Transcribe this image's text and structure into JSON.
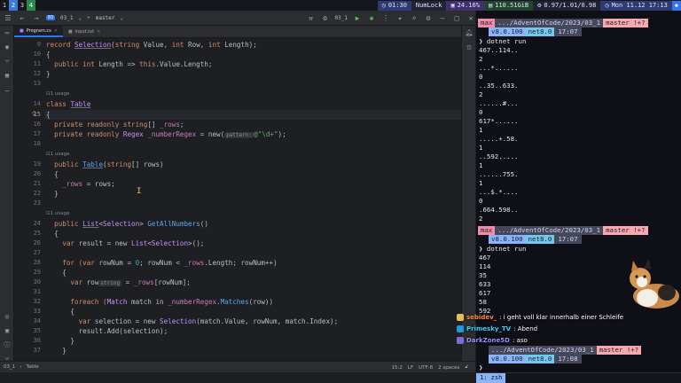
{
  "sysbar": {
    "workspaces": [
      "1",
      "2",
      "3",
      "4"
    ],
    "time_pill": "01:30",
    "numlock": "NumLock",
    "cpu": "24.16%",
    "mem": "110.51GiB",
    "load": "0.97/1.01/0.98",
    "datetime": "Mon 11.12 17:13"
  },
  "ide": {
    "project_badge": "03",
    "project_name": "03_1",
    "branch": "master",
    "config": "03_1",
    "tabs": [
      {
        "label": "Program.cs"
      },
      {
        "label": "input.txt"
      }
    ],
    "lines": [
      {
        "n": "9"
      },
      {
        "n": "10"
      },
      {
        "n": "11"
      },
      {
        "n": "12"
      },
      {
        "n": "13"
      },
      {
        "n": "14"
      },
      {
        "n": "15"
      },
      {
        "n": "16"
      },
      {
        "n": "17"
      },
      {
        "n": "18"
      },
      {
        "n": "19"
      },
      {
        "n": "20"
      },
      {
        "n": "21"
      },
      {
        "n": "22"
      },
      {
        "n": "23"
      },
      {
        "n": "24"
      },
      {
        "n": "25"
      },
      {
        "n": "26"
      },
      {
        "n": "27"
      },
      {
        "n": "28"
      },
      {
        "n": "29"
      },
      {
        "n": "30"
      },
      {
        "n": "31"
      },
      {
        "n": "32"
      },
      {
        "n": "33"
      },
      {
        "n": "34"
      },
      {
        "n": "35"
      },
      {
        "n": "36"
      },
      {
        "n": "37"
      }
    ],
    "hint_1usage": "1 usage",
    "inlay_pattern": "pattern:",
    "inlay_string": "string",
    "code": {
      "l9a": "record ",
      "l9b": "Selection",
      "l9c": "(",
      "l9d": "string",
      " l9e": "",
      "l9f": " Value, ",
      "l9g": "int",
      " l9h": "",
      "l9i": " Row, ",
      "l9j": "int",
      "l9k": " Length);",
      "l10": "{",
      "l11a": "  public ",
      "l11b": "int",
      " l11c": "",
      "l11d": " Length => ",
      "l11e": "this",
      ".l11f": "",
      "l11g": ".Value.Length;",
      "l12": "}",
      "l14a": "class ",
      "l14b": "Table",
      "l15": "{",
      "l16a": "  private readonly ",
      "l16b": "string",
      "l16c": "[] ",
      "l16d": "_rows",
      ";l16e": "",
      "l16f": ";",
      "l17a": "  private readonly ",
      "l17b": "Regex ",
      "l17c": "_numberRegex",
      " l17d": "",
      "l17e": " = new(",
      "l17f": "@\"\\d+\"",
      "l17g": ");",
      "l19a": "  public ",
      "l19b": "Table",
      "l19c": "(",
      "l19d": "string",
      "l19e": "[] rows)",
      "l20": "  {",
      "l21a": "    ",
      "l21b": "_rows",
      " l21c": "",
      "l21d": " = rows;",
      "l22": "  }",
      "l24a": "  public ",
      "l24b": "List",
      "l24c": "<",
      "l24d": "Selection",
      "l24e": "> ",
      "l24f": "GetAllNumbers",
      "l24g": "()",
      "l25": "  {",
      "l26a": "    var ",
      "l26b": "result = new ",
      "l26c": "List",
      "l26d": "<",
      "l26e": "Selection",
      "l26f": ">();",
      "l28a": "    for (",
      "l28b": "var ",
      "l28c": "rowNum = ",
      "l28d": "0",
      "l28e": "; rowNum < ",
      "l28f": "_rows",
      ".l28g": "",
      "l28h": ".Length; rowNum++)",
      "l29": "    {",
      "l30a": "      var ",
      "l30b": "row",
      "l30c": " = ",
      "l30d": "_rows",
      "l30e": "[rowNum];",
      "l32a": "      foreach (",
      "l32b": "Match ",
      "l32c": "match in ",
      "l32d": "_numberRegex",
      "l32e": ".",
      "l32f": "Matches",
      "l32g": "(row))",
      "l33": "      {",
      "l34a": "        var ",
      "l34b": "selection = new ",
      "l34c": "Selection",
      "l34d": "(match.Value, rowNum, match.Index);",
      "l35": "        result.Add(selection);",
      "l36": "      }",
      "l37": "    }"
    },
    "status": {
      "crumb1": "03_1",
      "crumb2": "Table",
      "pos": "15:2",
      "lf": "LF",
      "enc": "UTF-8",
      "indent": "2 spaces"
    }
  },
  "terminal": {
    "prompt1": {
      "user": "max",
      "path": ".../AdventOfCode/2023/03_1",
      "git": "master !+?",
      "ver": "v8.0.100",
      "net": "net8.0",
      "time": "17:07"
    },
    "cmd1": "❯ dotnet run",
    "out1": [
      "467..114..",
      "2",
      "...*......",
      "0",
      "..35..633.",
      "2",
      "......#...",
      "0",
      "617*......",
      "1",
      ".....+.58.",
      "1",
      "..592.....",
      "1",
      "......755.",
      "1",
      "...$.*....",
      "0",
      ".664.598..",
      "2"
    ],
    "prompt2": {
      "user": "max",
      "path": ".../AdventOfCode/2023/03_1",
      "git": "master !+?",
      "ver": "v8.0.100",
      "net": "net8.0",
      "time": "17:07"
    },
    "cmd2": "❯ dotnet run",
    "out2": [
      "467",
      "114",
      "35",
      "633",
      "617",
      "58",
      "592"
    ],
    "prompt3": {
      "path": ".../AdventOfCode/2023/03_1",
      "git": "master !+?",
      "ver": "v8.0.100",
      "net": "net8.0",
      "time": "17:08"
    },
    "cmd3": "❯",
    "tmux_window": "1: zsh"
  },
  "chat": [
    {
      "user": "sebidev_",
      "msg": ": i geht voll klar innerhalb einer Schleife",
      "color": "#ff8a3d"
    },
    {
      "user": "Primesky_TV",
      "msg": ": Abend",
      "color": "#2fd3ff"
    },
    {
      "user": "DarkZone5D",
      "msg": ": aso",
      "color": "#9a8cff"
    }
  ]
}
